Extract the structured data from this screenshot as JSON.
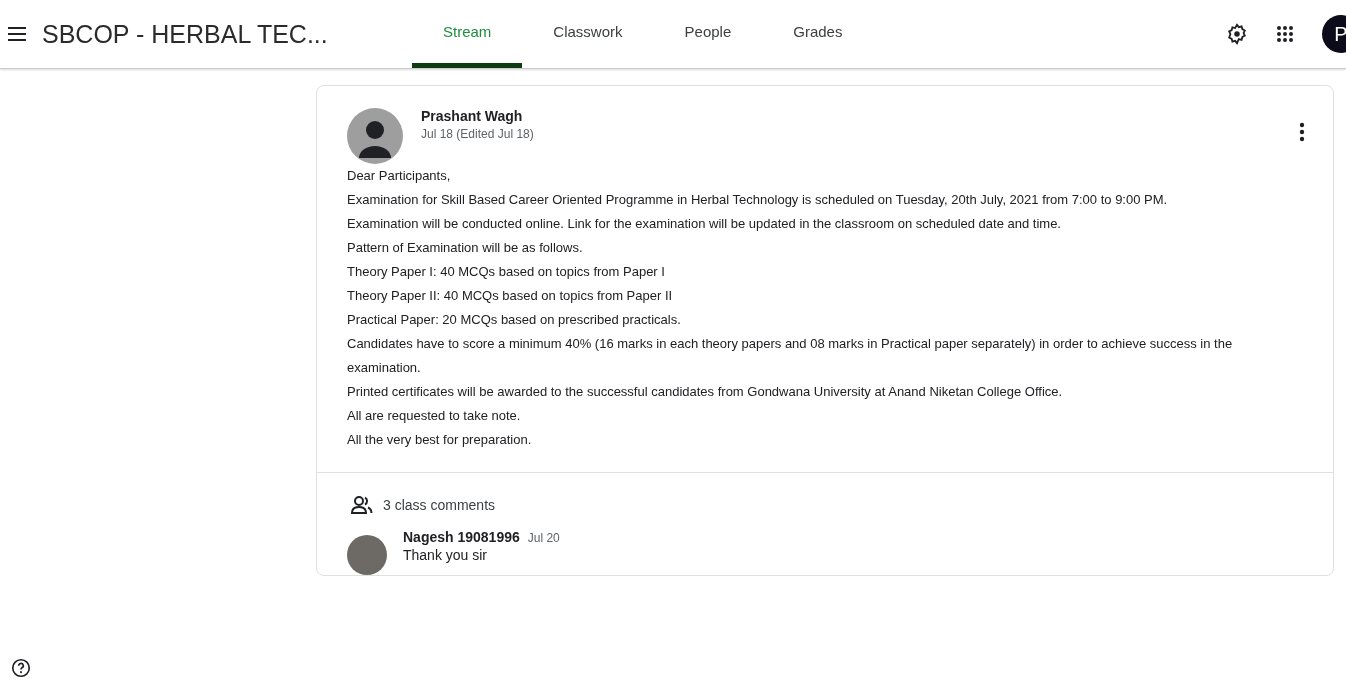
{
  "header": {
    "class_title": "SBCOP - HERBAL TEC...",
    "tabs": [
      {
        "label": "Stream",
        "selected": true
      },
      {
        "label": "Classwork",
        "selected": false
      },
      {
        "label": "People",
        "selected": false
      },
      {
        "label": "Grades",
        "selected": false
      }
    ],
    "account_initial": "P"
  },
  "post": {
    "author": "Prashant Wagh",
    "date": "Jul 18 (Edited Jul 18)",
    "body": [
      "Dear Participants,",
      "Examination for Skill Based Career Oriented Programme in Herbal Technology is scheduled on  Tuesday, 20th July, 2021 from 7:00 to 9:00 PM.",
      "Examination will be conducted online. Link for the examination will be updated in the classroom on scheduled date and time.",
      "Pattern of Examination will be as follows.",
      "Theory Paper I: 40 MCQs based on topics from Paper I",
      "Theory Paper II: 40 MCQs based on topics from Paper II",
      "Practical Paper: 20 MCQs based on prescribed practicals.",
      "Candidates have to score a minimum 40% (16 marks in each theory papers and 08 marks in Practical paper separately) in order to achieve success in the examination.",
      "Printed certificates will be awarded to the successful candidates from Gondwana University at Anand Niketan College Office.",
      "All are requested to take note.",
      "All the very best for preparation."
    ],
    "comments_label": "3 class comments",
    "comments": [
      {
        "author": "Nagesh 19081996",
        "date": "Jul 20",
        "text": "Thank you sir"
      }
    ]
  }
}
